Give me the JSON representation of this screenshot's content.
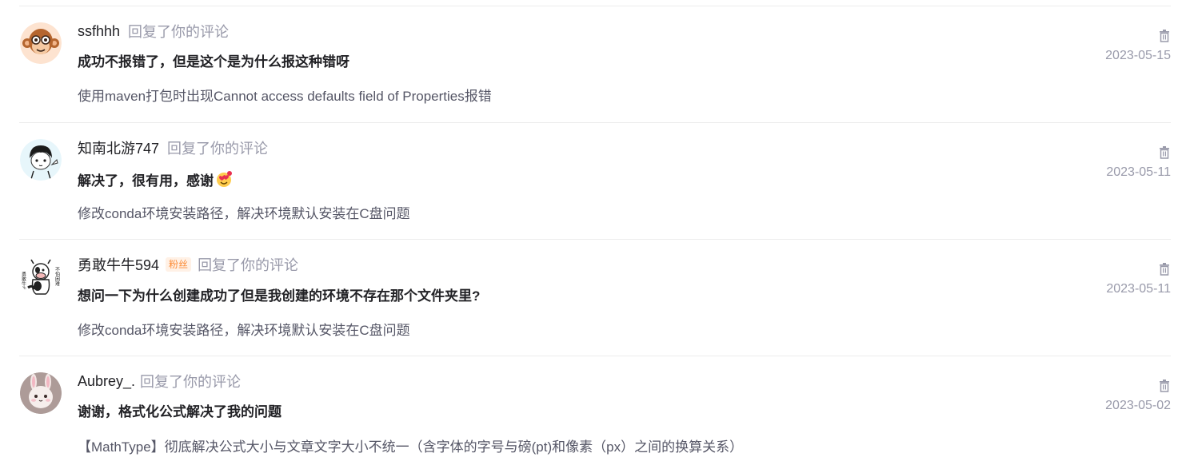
{
  "comments": [
    {
      "username": "ssfhhh",
      "badge": "",
      "action": "回复了你的评论",
      "reply": "成功不报错了，但是这个是为什么报这种错呀",
      "article": "使用maven打包时出现Cannot access defaults field of Properties报错",
      "date": "2023-05-15",
      "avatar_icon": "monkey-face-avatar-icon"
    },
    {
      "username": "知南北游747",
      "badge": "",
      "action": "回复了你的评论",
      "reply": "解决了，很有用，感谢",
      "reply_emoji": "heart-eyes-emoji-icon",
      "article": "修改conda环境安装路径，解决环境默认安装在C盘问题",
      "date": "2023-05-11",
      "avatar_icon": "cartoon-boy-avatar-icon"
    },
    {
      "username": "勇敢牛牛594",
      "badge": "粉丝",
      "action": "回复了你的评论",
      "reply": "想问一下为什么创建成功了但是我创建的环境不存在那个文件夹里?",
      "article": "修改conda环境安装路径，解决环境默认安装在C盘问题",
      "date": "2023-05-11",
      "avatar_icon": "cow-avatar-icon",
      "avatar_text_left": "勇敢牛牛",
      "avatar_text_right": "不怕困难"
    },
    {
      "username": "Aubrey_.",
      "badge": "",
      "action": "回复了你的评论",
      "reply": "谢谢，格式化公式解决了我的问题",
      "article": "【MathType】彻底解决公式大小与文章文字大小不统一（含字体的字号与磅(pt)和像素（px）之间的换算关系）",
      "date": "2023-05-02",
      "avatar_icon": "bunny-plush-avatar-icon"
    }
  ],
  "delete_icon": "trash-icon",
  "colors": {
    "text_primary": "#222226",
    "text_muted": "#999aaa",
    "text_secondary": "#555666",
    "badge_fg": "#fc8b36",
    "badge_bg": "#fff1e6",
    "divider": "#ececec"
  }
}
